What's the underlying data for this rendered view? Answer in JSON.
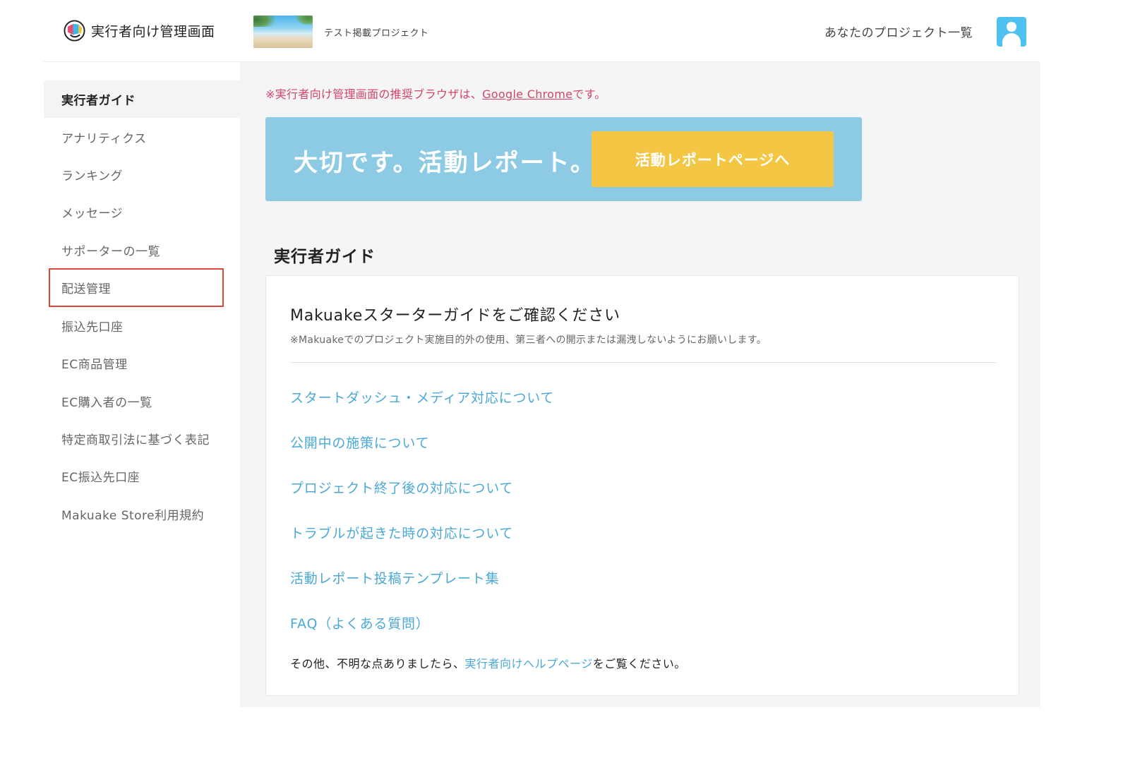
{
  "header": {
    "app_title": "実行者向け管理画面",
    "project_name": "テスト掲載プロジェクト",
    "projects_link": "あなたのプロジェクト一覧"
  },
  "sidebar": {
    "items": [
      {
        "label": "実行者ガイド"
      },
      {
        "label": "アナリティクス"
      },
      {
        "label": "ランキング"
      },
      {
        "label": "メッセージ"
      },
      {
        "label": "サポーターの一覧"
      },
      {
        "label": "配送管理"
      },
      {
        "label": "振込先口座"
      },
      {
        "label": "EC商品管理"
      },
      {
        "label": "EC購入者の一覧"
      },
      {
        "label": "特定商取引法に基づく表記"
      },
      {
        "label": "EC振込先口座"
      },
      {
        "label": "Makuake Store利用規約"
      }
    ]
  },
  "main": {
    "notice_prefix": "※実行者向け管理画面の推奨ブラウザは、",
    "notice_link": "Google Chrome",
    "notice_suffix": "です。",
    "banner_text": "大切です。活動レポート。",
    "banner_button": "活動レポートページへ",
    "section_title": "実行者ガイド",
    "card_title": "Makuakeスターターガイドをご確認ください",
    "card_note": "※Makuakeでのプロジェクト実施目的外の使用、第三者への開示または漏洩しないようにお願いします。",
    "links": [
      "スタートダッシュ・メディア対応について",
      "公開中の施策について",
      "プロジェクト終了後の対応について",
      "トラブルが起きた時の対応について",
      "活動レポート投稿テンプレート集",
      "FAQ（よくある質問）"
    ],
    "footer_prefix": "その他、不明な点ありましたら、",
    "footer_link": "実行者向けヘルプページ",
    "footer_suffix": "をご覧ください。"
  },
  "colors": {
    "accent_blue": "#4aa9d6",
    "banner_bg": "#8ccbe3",
    "banner_button": "#f3c744",
    "notice": "#d4456a",
    "highlight": "#e0463a"
  },
  "icons": {
    "logo": "makuake-logo-icon",
    "avatar": "user-avatar-icon"
  }
}
